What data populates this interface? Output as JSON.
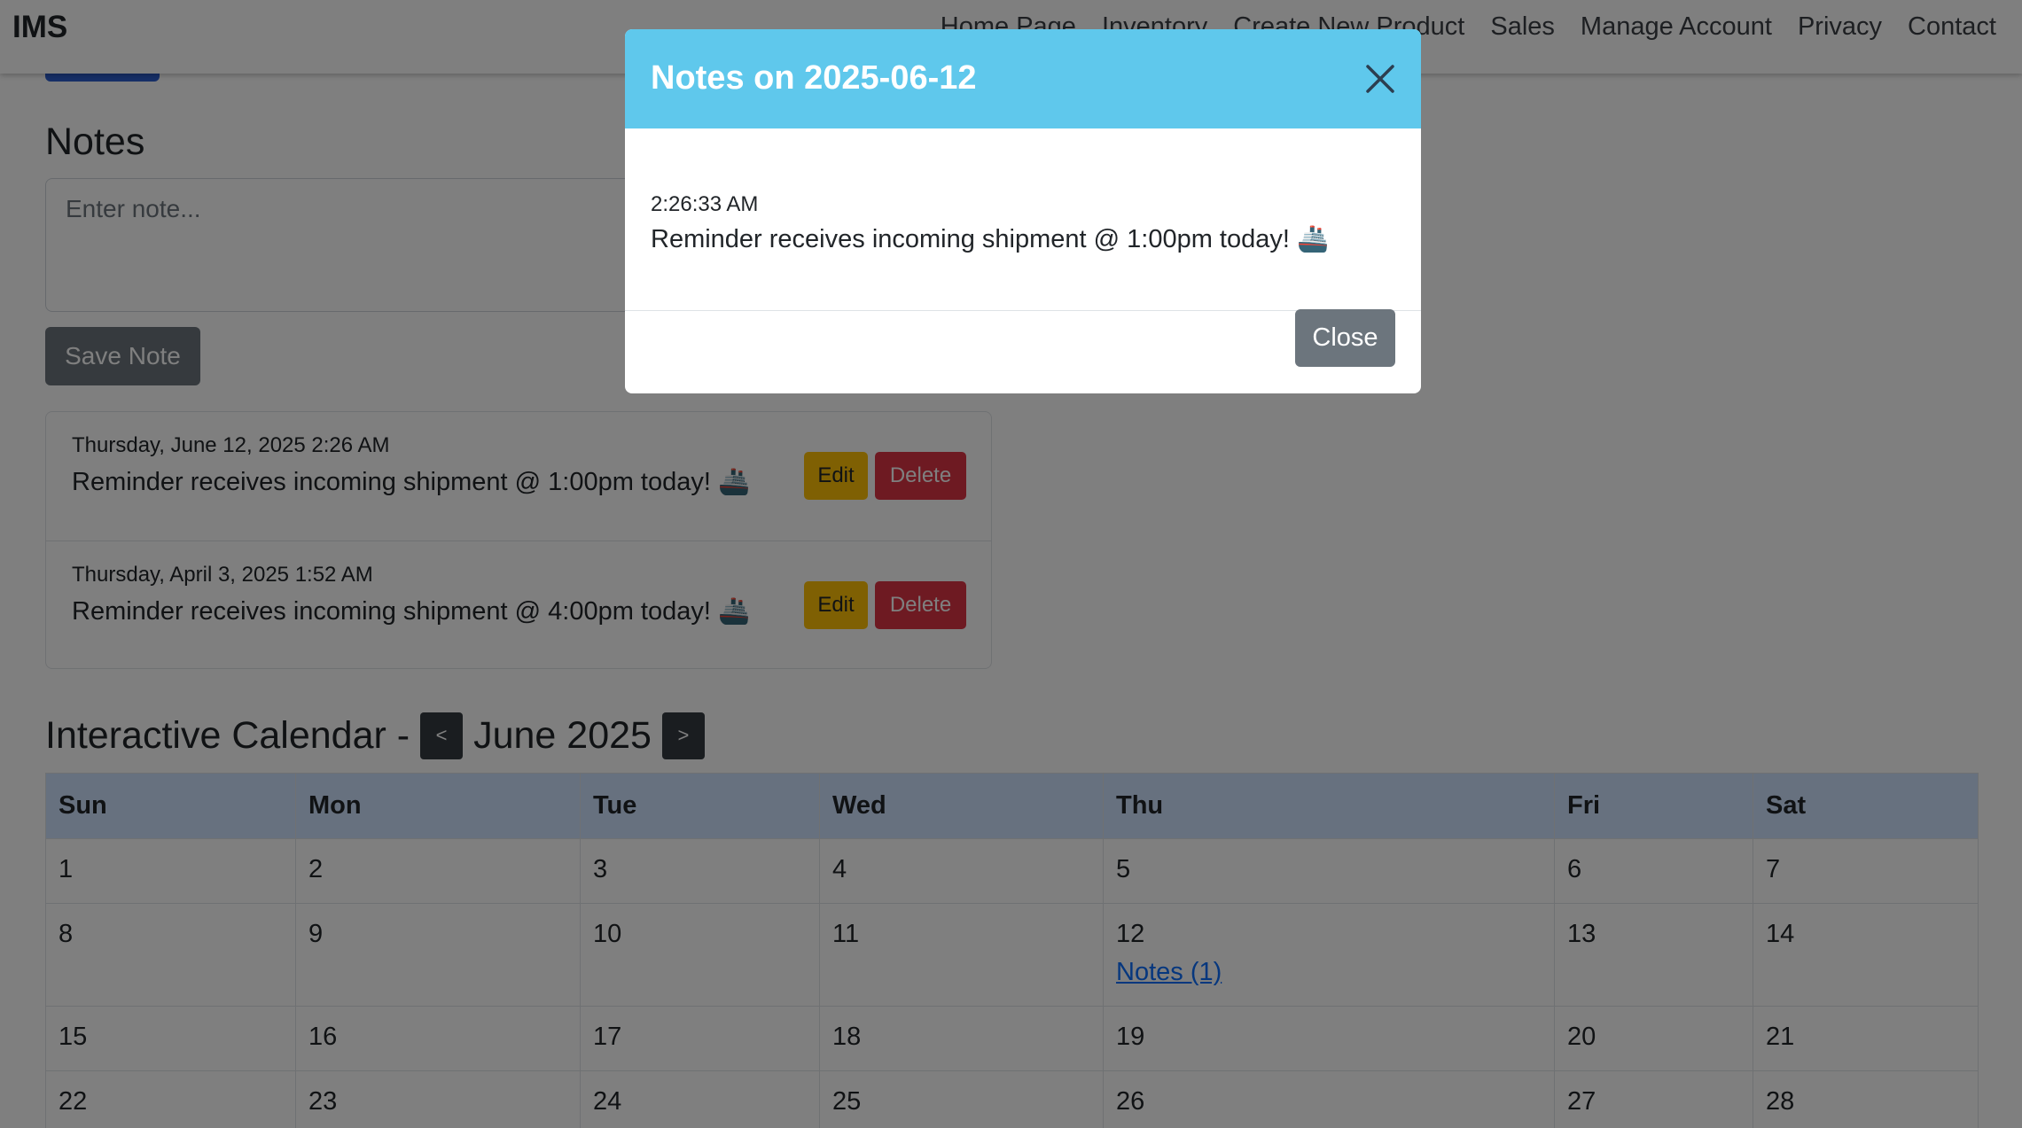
{
  "navbar": {
    "brand": "IMS",
    "links": [
      "Home Page",
      "Inventory",
      "Create New Product",
      "Sales",
      "Manage Account",
      "Privacy",
      "Contact"
    ]
  },
  "notes": {
    "title": "Notes",
    "input_placeholder": "Enter note...",
    "save_label": "Save Note",
    "items": [
      {
        "date": "Thursday, June 12, 2025 2:26 AM",
        "text": "Reminder receives incoming shipment @ 1:00pm today! 🚢",
        "edit_label": "Edit",
        "delete_label": "Delete"
      },
      {
        "date": "Thursday, April 3, 2025 1:52 AM",
        "text": "Reminder receives incoming shipment @ 4:00pm today! 🚢",
        "edit_label": "Edit",
        "delete_label": "Delete"
      }
    ]
  },
  "calendar": {
    "title": "Interactive Calendar -",
    "prev_label": "<",
    "next_label": ">",
    "month": "June 2025",
    "days": [
      "Sun",
      "Mon",
      "Tue",
      "Wed",
      "Thu",
      "Fri",
      "Sat"
    ],
    "weeks": [
      [
        "1",
        "2",
        "3",
        "4",
        "5",
        "6",
        "7"
      ],
      [
        "8",
        "9",
        "10",
        "11",
        "12",
        "13",
        "14"
      ],
      [
        "15",
        "16",
        "17",
        "18",
        "19",
        "20",
        "21"
      ],
      [
        "22",
        "23",
        "24",
        "25",
        "26",
        "27",
        "28"
      ]
    ],
    "notes_link": "Notes (1)"
  },
  "modal": {
    "title": "Notes on 2025-06-12",
    "time": "2:26:33 AM",
    "text": "Reminder receives incoming shipment @ 1:00pm today! 🚢",
    "close_label": "Close"
  },
  "colors": {
    "header_bg": "#cfe2ff",
    "modal_header_bg": "#5fc8ec",
    "edit_button": "#ffc107",
    "delete_button": "#dc3545",
    "secondary_button": "#6c757d",
    "link": "#0d6efd"
  }
}
